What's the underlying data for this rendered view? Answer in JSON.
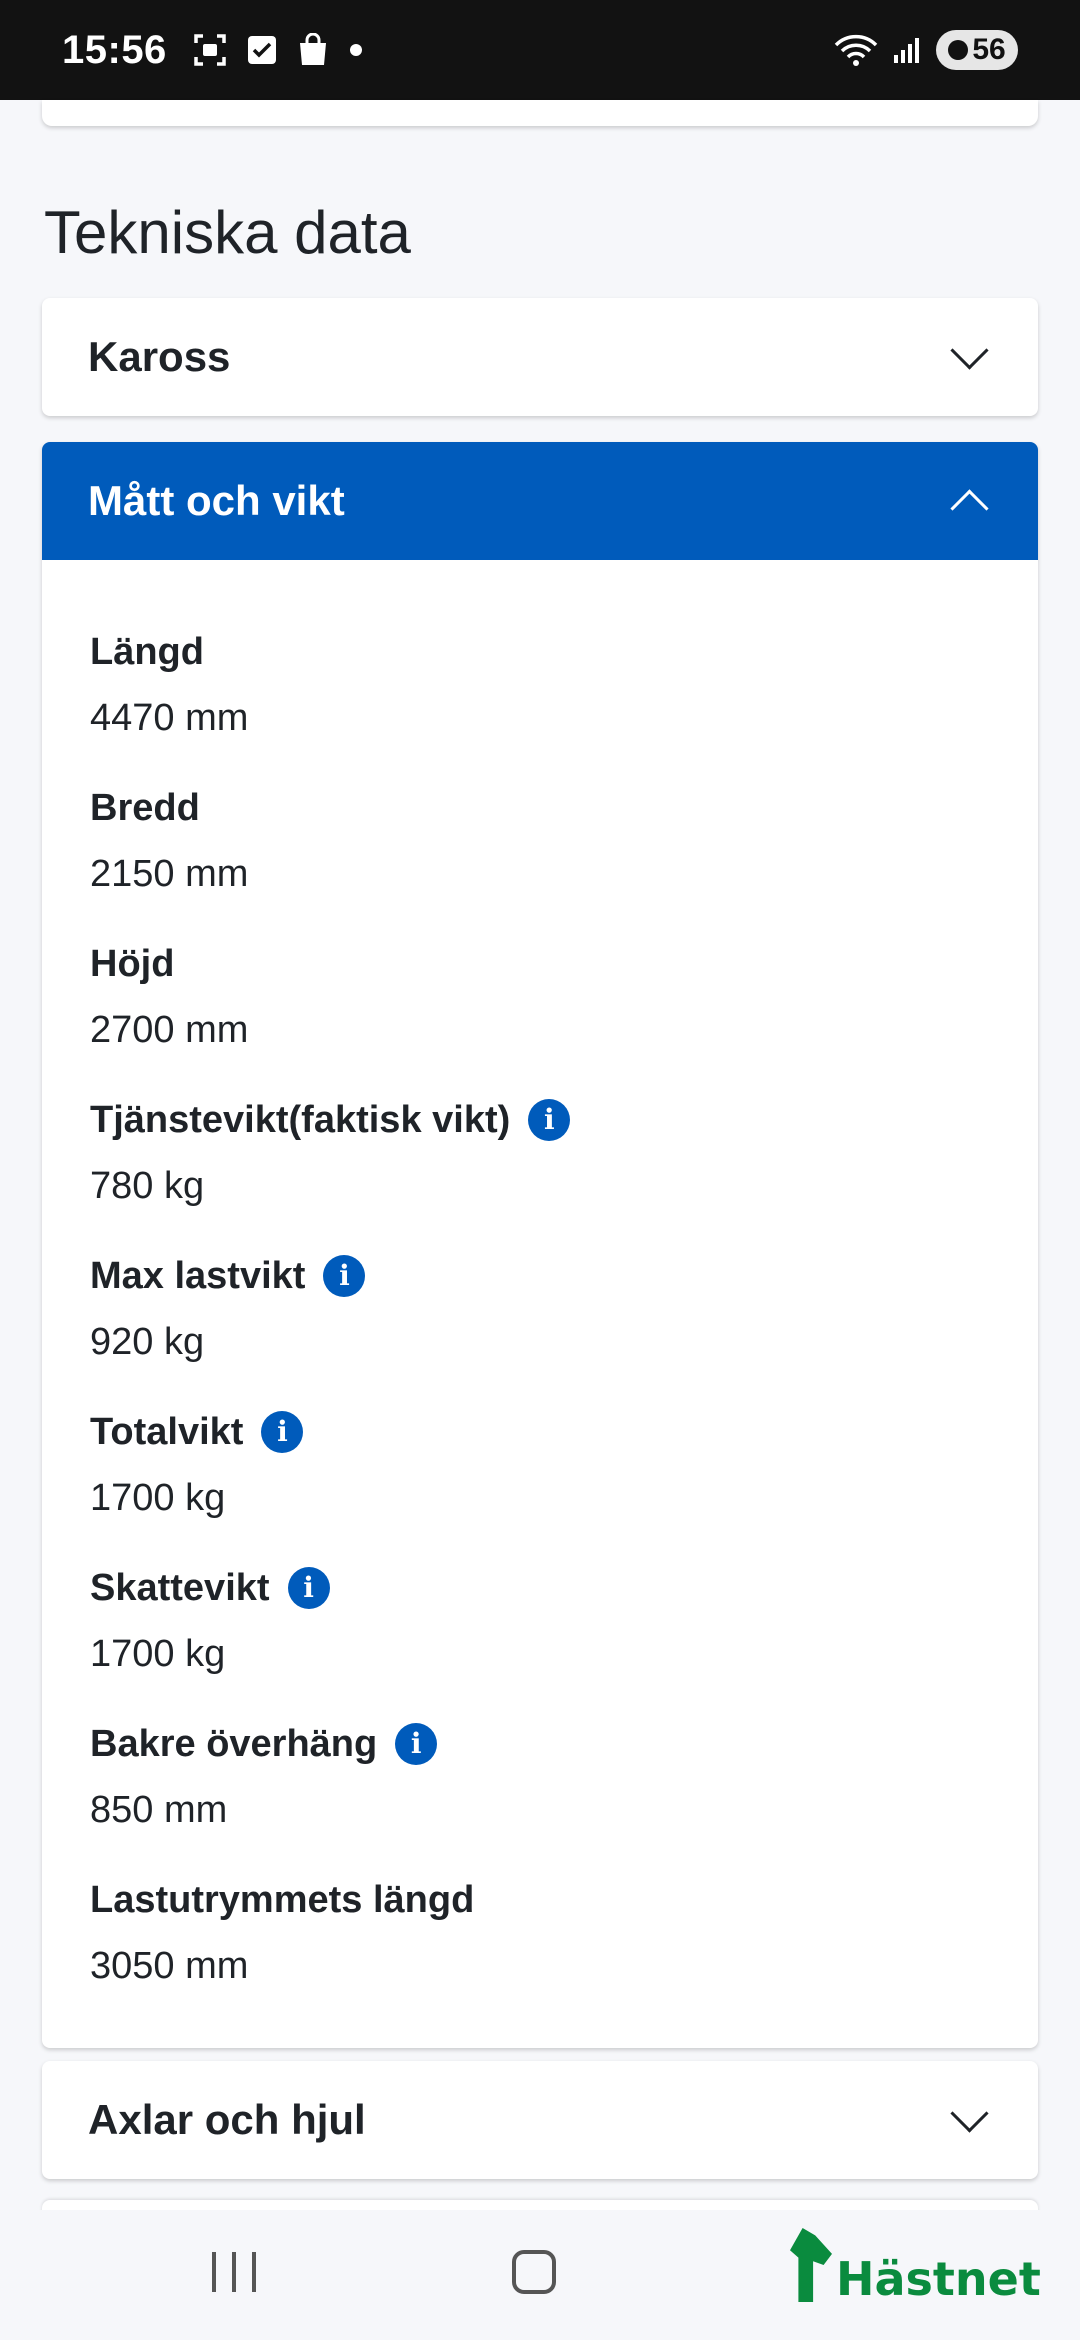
{
  "status_bar": {
    "time": "15:56",
    "battery": "56"
  },
  "page": {
    "title": "Tekniska data"
  },
  "panels": {
    "kaross": {
      "label": "Kaross"
    },
    "matt_och_vikt": {
      "label": "Mått och vikt",
      "specs": [
        {
          "label": "Längd",
          "value": "4470 mm"
        },
        {
          "label": "Bredd",
          "value": "2150 mm"
        },
        {
          "label": "Höjd",
          "value": "2700 mm"
        },
        {
          "label": "Tjänstevikt(faktisk vikt)",
          "value": "780 kg"
        },
        {
          "label": "Max lastvikt",
          "value": "920 kg"
        },
        {
          "label": "Totalvikt",
          "value": "1700 kg"
        },
        {
          "label": "Skattevikt",
          "value": "1700 kg"
        },
        {
          "label": "Bakre överhäng",
          "value": "850 mm"
        },
        {
          "label": "Lastutrymmets längd",
          "value": "3050 mm"
        }
      ]
    },
    "axlar_och_hjul": {
      "label": "Axlar och hjul"
    }
  },
  "logo": {
    "text": "Hästnet"
  },
  "colors": {
    "accent": "#005bbb",
    "logo": "#0a8b3e"
  }
}
